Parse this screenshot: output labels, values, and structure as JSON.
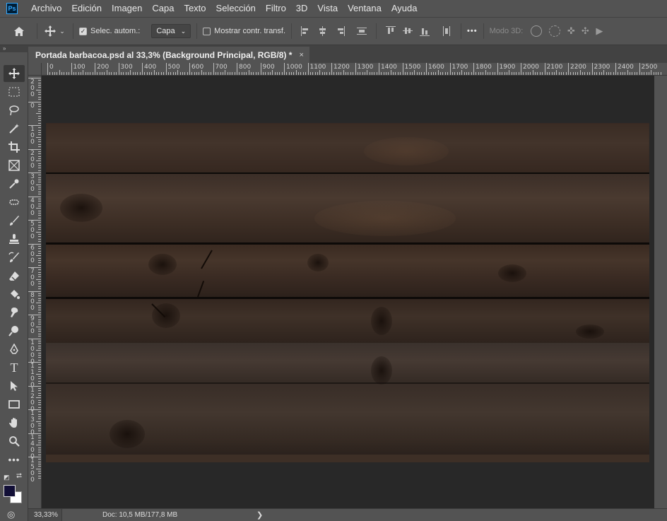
{
  "app": {
    "logo_text": "Ps"
  },
  "menu": [
    "Archivo",
    "Edición",
    "Imagen",
    "Capa",
    "Texto",
    "Selección",
    "Filtro",
    "3D",
    "Vista",
    "Ventana",
    "Ayuda"
  ],
  "options": {
    "auto_select_label": "Selec. autom.:",
    "auto_select_checked": true,
    "auto_select_target": "Capa",
    "show_transform_label": "Mostrar contr. transf.",
    "show_transform_checked": false,
    "mode_3d_label": "Modo 3D:",
    "more_label": "•••"
  },
  "document": {
    "tab_title": "Portada barbacoa.psd al 33,3% (Background Principal, RGB/8) *",
    "close_glyph": "×"
  },
  "ruler_h_labels": [
    "0",
    "100",
    "200",
    "300",
    "400",
    "500",
    "600",
    "700",
    "800",
    "900",
    "1000",
    "1100",
    "1200",
    "1300",
    "1400",
    "1500",
    "1600",
    "1700",
    "1800",
    "1900",
    "2000",
    "2100",
    "2200",
    "2300",
    "2400",
    "2500"
  ],
  "ruler_v_labels": [
    "2\n0\n0",
    "0",
    "1\n0\n0",
    "2\n0\n0",
    "3\n0\n0",
    "4\n0\n0",
    "5\n0\n0",
    "6\n0\n0",
    "7\n0\n0",
    "8\n0\n0",
    "9\n0\n0",
    "1\n0\n0\n0",
    "1\n1\n0\n0",
    "1\n2\n0\n0",
    "1\n3\n0\n0",
    "1\n4\n0\n0",
    "1\n5\n0\n0"
  ],
  "tools": [
    {
      "name": "move-tool",
      "glyph": "✥",
      "active": true
    },
    {
      "name": "marquee-tool",
      "glyph": "⬚"
    },
    {
      "name": "lasso-tool",
      "glyph": "ʘ"
    },
    {
      "name": "magic-wand-tool",
      "glyph": "⚚"
    },
    {
      "name": "crop-tool",
      "glyph": "⌗"
    },
    {
      "name": "frame-tool",
      "glyph": "⊠"
    },
    {
      "name": "eyedropper-tool",
      "glyph": "✎"
    },
    {
      "name": "healing-brush-tool",
      "glyph": "⛶"
    },
    {
      "name": "brush-tool",
      "glyph": "✐"
    },
    {
      "name": "clone-stamp-tool",
      "glyph": "⚲"
    },
    {
      "name": "history-brush-tool",
      "glyph": "✍"
    },
    {
      "name": "eraser-tool",
      "glyph": "⌫"
    },
    {
      "name": "paint-bucket-tool",
      "glyph": "⛽"
    },
    {
      "name": "smudge-tool",
      "glyph": "☝"
    },
    {
      "name": "dodge-tool",
      "glyph": "●"
    },
    {
      "name": "pen-tool",
      "glyph": "✒"
    },
    {
      "name": "type-tool",
      "glyph": "T"
    },
    {
      "name": "path-selection-tool",
      "glyph": "➤"
    },
    {
      "name": "rectangle-tool",
      "glyph": "▭"
    },
    {
      "name": "hand-tool",
      "glyph": "✋"
    },
    {
      "name": "zoom-tool",
      "glyph": "⚲"
    },
    {
      "name": "edit-toolbar",
      "glyph": "•••"
    }
  ],
  "colors": {
    "foreground": "#120f36",
    "background": "#ffffff",
    "wood_base": "#2f2621"
  },
  "status": {
    "zoom": "33,33%",
    "doc_info": "Doc: 10,5 MB/177,8 MB",
    "arrow": "❯"
  }
}
